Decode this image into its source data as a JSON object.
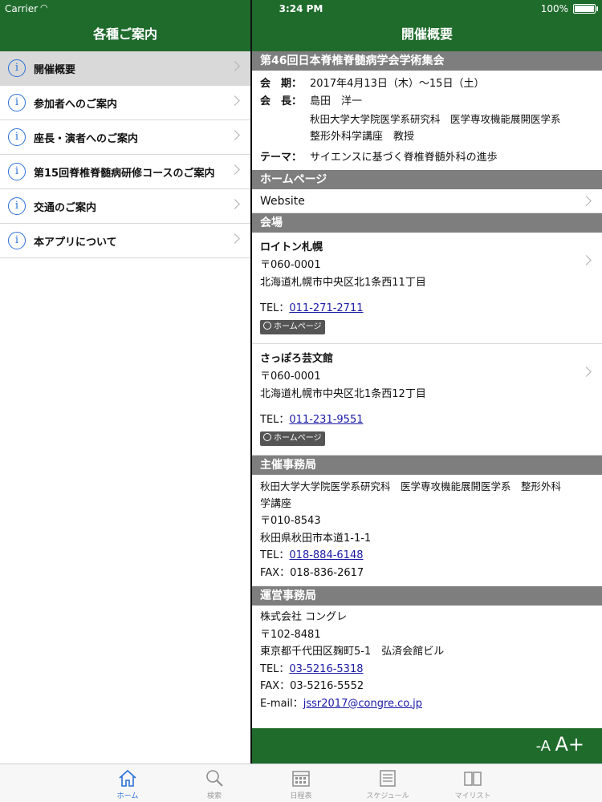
{
  "status": {
    "carrier": "Carrier",
    "time": "3:24 PM",
    "battery": "100%"
  },
  "left": {
    "title": "各種ご案内",
    "items": [
      {
        "label": "開催概要"
      },
      {
        "label": "参加者へのご案内"
      },
      {
        "label": "座長・演者へのご案内"
      },
      {
        "label": "第15回脊椎脊髄病研修コースのご案内"
      },
      {
        "label": "交通のご案内"
      },
      {
        "label": "本アプリについて"
      }
    ]
  },
  "right": {
    "title": "開催概要",
    "event_title": "第46回日本脊椎脊髄病学会学術集会",
    "period_label": "会　期：",
    "period_value": "2017年4月13日（木）〜15日（土）",
    "chair_label": "会　長：",
    "chair_name": "島田　洋一",
    "chair_aff1": "秋田大学大学院医学系研究科　医学専攻機能展開医学系",
    "chair_aff2": "整形外科学講座　教授",
    "theme_label": "テーマ：",
    "theme_value": "サイエンスに基づく脊椎脊髄外科の進歩",
    "homepage_header": "ホームページ",
    "website_label": "Website",
    "venue_header": "会場",
    "venues": [
      {
        "name": "ロイトン札幌",
        "zip": "〒060-0001",
        "address": "北海道札幌市中央区北1条西11丁目",
        "tel_label": "TEL：",
        "tel": "011-271-2711",
        "hp_label": "ホームページ"
      },
      {
        "name": "さっぽろ芸文館",
        "zip": "〒060-0001",
        "address": "北海道札幌市中央区北1条西12丁目",
        "tel_label": "TEL：",
        "tel": "011-231-9551",
        "hp_label": "ホームページ"
      }
    ],
    "host_header": "主催事務局",
    "host_line1": "秋田大学大学院医学系研究科　医学専攻機能展開医学系　整形外科",
    "host_line2": "学講座",
    "host_zip": "〒010-8543",
    "host_address": "秋田県秋田市本道1-1-1",
    "host_tel_label": "TEL：",
    "host_tel": "018-884-6148",
    "host_fax": "FAX：018-836-2617",
    "ops_header": "運営事務局",
    "ops_company": "株式会社 コングレ",
    "ops_zip": "〒102-8481",
    "ops_address": "東京都千代田区麹町5-1　弘済会館ビル",
    "ops_tel_label": "TEL：",
    "ops_tel": "03-5216-5318",
    "ops_fax": "FAX：03-5216-5552",
    "ops_email_label": "E-mail：",
    "ops_email": "jssr2017@congre.co.jp"
  },
  "fontbar": {
    "small": "-A",
    "large": "A+"
  },
  "tabs": [
    {
      "label": "ホーム",
      "icon": "home-icon",
      "active": true
    },
    {
      "label": "検索",
      "icon": "search-icon"
    },
    {
      "label": "日程表",
      "icon": "calendar-icon"
    },
    {
      "label": "スケジュール",
      "icon": "schedule-icon"
    },
    {
      "label": "マイリスト",
      "icon": "book-icon"
    }
  ],
  "colors": {
    "nav_green": "#1f6b2c",
    "section_gray": "#7e7e7e",
    "accent_blue": "#2a6fd6"
  }
}
